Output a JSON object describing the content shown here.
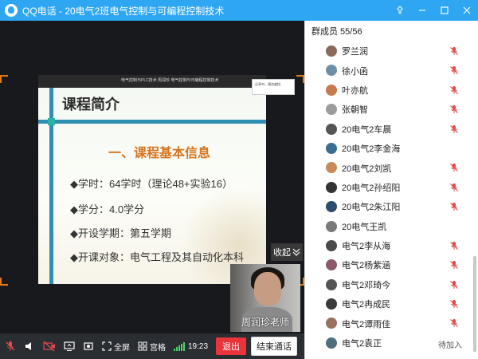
{
  "app": {
    "title": "QQ电话 - 20电气2班电气控制与可编程控制技术"
  },
  "slide": {
    "header": "电气控制与PLC技术   周润珍   电气控制与可编程控制技术",
    "title": "课程简介",
    "subtitle": "一、课程基本信息",
    "items": [
      "◆学时：64学时（理论48+实验16）",
      "◆学分：4.0学分",
      "◆开设学期：第五学期",
      "◆开课对象：电气工程及其自动化本科"
    ]
  },
  "share_box": "分享中，请勿遮挡",
  "collapse_label": "收起",
  "speaker_name": "周润珍老师",
  "toolbar": {
    "fullscreen": "全屏",
    "grid": "宫格",
    "time": "19:23",
    "leave": "退出",
    "end_call": "结束通话"
  },
  "panel": {
    "header": "群成员 55/56",
    "members": [
      {
        "name": "罗兰润",
        "muted": true,
        "color": "#8a6a5a"
      },
      {
        "name": "徐小函",
        "muted": true,
        "color": "#6f8fa8"
      },
      {
        "name": "叶亦航",
        "muted": true,
        "color": "#c57a4f"
      },
      {
        "name": "张朝智",
        "muted": true,
        "color": "#9c9c9c"
      },
      {
        "name": "20电气2车晨",
        "muted": true,
        "color": "#555"
      },
      {
        "name": "20电气2李金海",
        "muted": false,
        "color": "#3a6f8f"
      },
      {
        "name": "20电气2刘凯",
        "muted": true,
        "color": "#c98a5a"
      },
      {
        "name": "20电气2孙绍阳",
        "muted": true,
        "color": "#333"
      },
      {
        "name": "20电气2朱江阳",
        "muted": true,
        "color": "#2d4d6d"
      },
      {
        "name": "20电气王凯",
        "muted": false,
        "color": "#7a7a7a"
      },
      {
        "name": "电气2李从海",
        "muted": true,
        "color": "#4a4a4a"
      },
      {
        "name": "电气2杨紫涵",
        "muted": true,
        "color": "#8a5a6a"
      },
      {
        "name": "电气2邓琦今",
        "muted": true,
        "color": "#555"
      },
      {
        "name": "电气2冉成民",
        "muted": true,
        "color": "#3a3a3a"
      },
      {
        "name": "电气2谭雨佳",
        "muted": true,
        "color": "#9a7060"
      },
      {
        "name": "电气2袁正",
        "muted": false,
        "pending": "待加入",
        "color": "#4f6f7f"
      }
    ]
  },
  "colors": {
    "titlebar": "#2fa6f2",
    "accent_orange": "#d6741e",
    "mic_muted": "#e34b4b",
    "leave_button": "#e8343a"
  }
}
